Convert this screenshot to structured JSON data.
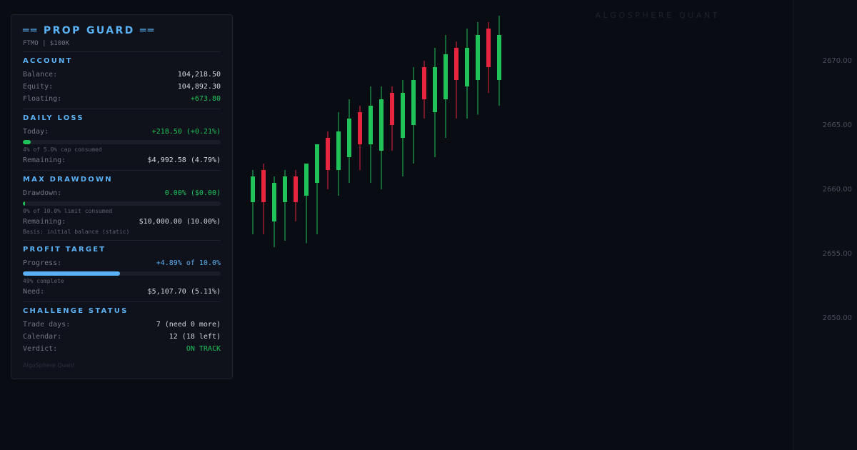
{
  "colors": {
    "background": "#0a0c13",
    "accent": "#5ab0f2",
    "bull": "#20c25a",
    "bear": "#e8253f"
  },
  "watermark": "ALGOSPHERE QUANT",
  "price_axis": {
    "labels": [
      "2670.00",
      "2665.00",
      "2660.00",
      "2655.00",
      "2650.00"
    ]
  },
  "panel": {
    "title": "══ PROP GUARD ══",
    "subtitle": "FTMO | $100K",
    "account": {
      "heading": "ACCOUNT",
      "rows": [
        {
          "label": "Balance:",
          "value": "104,218.50",
          "tone": "normal"
        },
        {
          "label": "Equity:",
          "value": "104,892.30",
          "tone": "normal"
        },
        {
          "label": "Floating:",
          "value": "+673.80",
          "tone": "green"
        }
      ]
    },
    "daily_loss": {
      "heading": "DAILY LOSS",
      "today_label": "Today:",
      "today_value": "+218.50 (+0.21%)",
      "progress": 0.04,
      "note": "4% of 5.0% cap consumed",
      "remaining_label": "Remaining:",
      "remaining_value": "$4,992.58 (4.79%)"
    },
    "max_drawdown": {
      "heading": "MAX DRAWDOWN",
      "drawdown_label": "Drawdown:",
      "drawdown_value": "0.00% ($0.00)",
      "progress": 0.0,
      "note": "0% of 10.0% limit consumed",
      "remaining_label": "Remaining:",
      "remaining_value": "$10,000.00 (10.00%)",
      "basis": "Basis: initial balance (static)"
    },
    "profit_target": {
      "heading": "PROFIT TARGET",
      "progress_label": "Progress:",
      "progress_value": "+4.89% of 10.0%",
      "progress": 0.49,
      "note": "49% complete",
      "need_label": "Need:",
      "need_value": "$5,107.70 (5.11%)"
    },
    "challenge": {
      "heading": "CHALLENGE STATUS",
      "rows": [
        {
          "label": "Trade days:",
          "value": "7 (need 0 more)",
          "tone": "normal"
        },
        {
          "label": "Calendar:",
          "value": "12 (18 left)",
          "tone": "normal"
        },
        {
          "label": "Verdict:",
          "value": "ON TRACK",
          "tone": "green"
        }
      ]
    },
    "footer": "AlgoSphere Quant"
  },
  "candles": [
    {
      "o": 2659.0,
      "h": 2661.5,
      "l": 2656.5,
      "c": 2661.0
    },
    {
      "o": 2661.5,
      "h": 2662.0,
      "l": 2656.5,
      "c": 2659.0
    },
    {
      "o": 2657.5,
      "h": 2661.0,
      "l": 2655.5,
      "c": 2660.5
    },
    {
      "o": 2659.0,
      "h": 2661.5,
      "l": 2656.0,
      "c": 2661.0
    },
    {
      "o": 2661.0,
      "h": 2661.5,
      "l": 2657.5,
      "c": 2659.0
    },
    {
      "o": 2659.5,
      "h": 2662.0,
      "l": 2655.8,
      "c": 2662.0
    },
    {
      "o": 2660.5,
      "h": 2663.0,
      "l": 2656.5,
      "c": 2663.5
    },
    {
      "o": 2664.0,
      "h": 2664.5,
      "l": 2660.0,
      "c": 2661.5
    },
    {
      "o": 2661.5,
      "h": 2666.0,
      "l": 2659.5,
      "c": 2664.5
    },
    {
      "o": 2662.5,
      "h": 2667.0,
      "l": 2660.5,
      "c": 2665.5
    },
    {
      "o": 2666.0,
      "h": 2666.5,
      "l": 2661.5,
      "c": 2663.5
    },
    {
      "o": 2663.5,
      "h": 2668.0,
      "l": 2660.5,
      "c": 2666.5
    },
    {
      "o": 2663.0,
      "h": 2668.0,
      "l": 2660.0,
      "c": 2667.0
    },
    {
      "o": 2667.5,
      "h": 2668.0,
      "l": 2663.0,
      "c": 2665.0
    },
    {
      "o": 2664.0,
      "h": 2668.5,
      "l": 2661.0,
      "c": 2667.5
    },
    {
      "o": 2665.0,
      "h": 2669.5,
      "l": 2662.0,
      "c": 2668.5
    },
    {
      "o": 2669.5,
      "h": 2670.0,
      "l": 2665.5,
      "c": 2667.0
    },
    {
      "o": 2666.0,
      "h": 2671.0,
      "l": 2662.5,
      "c": 2669.5
    },
    {
      "o": 2667.0,
      "h": 2672.0,
      "l": 2664.0,
      "c": 2670.5
    },
    {
      "o": 2671.0,
      "h": 2671.5,
      "l": 2665.5,
      "c": 2668.5
    },
    {
      "o": 2668.0,
      "h": 2672.5,
      "l": 2665.5,
      "c": 2671.0
    },
    {
      "o": 2668.5,
      "h": 2673.0,
      "l": 2665.8,
      "c": 2672.0
    },
    {
      "o": 2672.5,
      "h": 2673.0,
      "l": 2667.5,
      "c": 2669.5
    },
    {
      "o": 2668.5,
      "h": 2673.5,
      "l": 2666.5,
      "c": 2672.0
    }
  ]
}
